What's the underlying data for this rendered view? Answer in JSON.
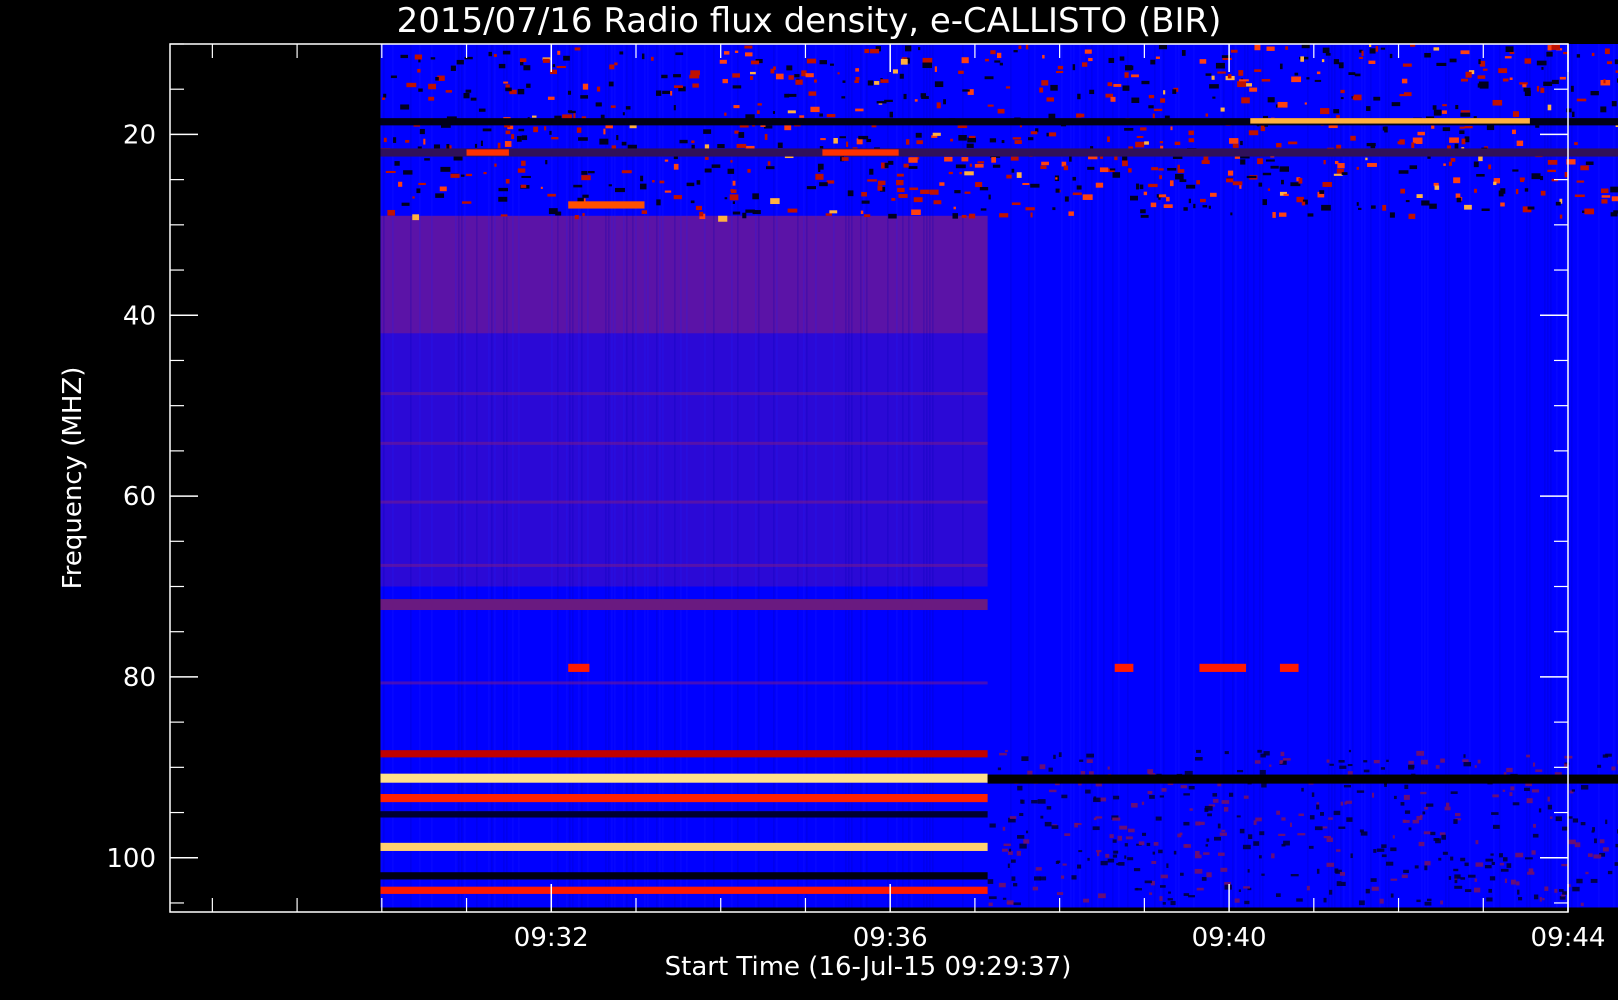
{
  "chart_data": {
    "type": "heatmap",
    "title": "2015/07/16  Radio flux density, e-CALLISTO (BIR)",
    "xlabel": "Start Time (16-Jul-15 09:29:37)",
    "ylabel": "Frequency (MHZ)",
    "y_axis": {
      "inverted": true,
      "range": [
        10,
        106
      ],
      "ticks": [
        20,
        40,
        60,
        80,
        100
      ],
      "tick_labels": [
        "20",
        "40",
        "60",
        "80",
        "100"
      ],
      "minor_step": 5
    },
    "x_axis": {
      "range_minutes": [
        -2.5,
        14.0
      ],
      "ticks_minutes": [
        2,
        6,
        10,
        14
      ],
      "tick_labels": [
        "09:32",
        "09:36",
        "09:40",
        "09:44"
      ],
      "minor_step_minutes": 1
    },
    "data_extent": {
      "time_start_minutes": -0.0167,
      "time_end_minutes": 15.0,
      "freq_min": 10,
      "freq_max": 105.5,
      "second_segment_start_minutes": 7.15
    },
    "colors": {
      "background": "#0000ff",
      "bright": "#ffd060",
      "mid": "#ff2000",
      "dark": "#000000",
      "segment1_tint": "#7a1a8a"
    },
    "features": [
      {
        "kind": "band",
        "segment": 1,
        "freq": 91.2,
        "width": 1.0,
        "color": "#ffe08a",
        "label": "bright band"
      },
      {
        "kind": "band",
        "segment": 1,
        "freq": 98.8,
        "width": 0.9,
        "color": "#ffd070",
        "label": "bright band"
      },
      {
        "kind": "band",
        "segment": 1,
        "freq": 93.4,
        "width": 0.9,
        "color": "#ff2000",
        "label": "red band"
      },
      {
        "kind": "band",
        "segment": 1,
        "freq": 103.6,
        "width": 0.8,
        "color": "#ff1800",
        "label": "red band"
      },
      {
        "kind": "band",
        "segment": 1,
        "freq": 88.5,
        "width": 0.8,
        "color": "#c00000",
        "label": "red band"
      },
      {
        "kind": "band",
        "segment": 1,
        "freq": 102.0,
        "width": 0.8,
        "color": "#000010",
        "label": "dark band"
      },
      {
        "kind": "band",
        "segment": 1,
        "freq": 95.2,
        "width": 0.7,
        "color": "#000030",
        "label": "dark band"
      },
      {
        "kind": "band",
        "segment": 1,
        "freq": 72.0,
        "width": 1.2,
        "color": "#6a1a80",
        "label": "purple band"
      },
      {
        "kind": "band",
        "segment": 2,
        "freq": 91.3,
        "width": 1.0,
        "color": "#000000",
        "label": "dark band"
      },
      {
        "kind": "band",
        "segment": "all",
        "freq": 18.6,
        "width": 0.8,
        "color": "#000018",
        "label": "dark band"
      },
      {
        "kind": "band",
        "segment": "all",
        "freq": 22.0,
        "width": 0.9,
        "color": "#30105a",
        "label": "band"
      },
      {
        "kind": "burst",
        "t": 2.2,
        "freq": 79.0,
        "dt": 0.25,
        "df": 0.9,
        "color": "#ff1a00"
      },
      {
        "kind": "burst",
        "t": 8.65,
        "freq": 79.0,
        "dt": 0.22,
        "df": 0.9,
        "color": "#ff1a00"
      },
      {
        "kind": "burst",
        "t": 9.65,
        "freq": 79.0,
        "dt": 0.55,
        "df": 0.9,
        "color": "#ff1a00"
      },
      {
        "kind": "burst",
        "t": 10.6,
        "freq": 79.0,
        "dt": 0.22,
        "df": 0.9,
        "color": "#ff1a00"
      },
      {
        "kind": "burst",
        "t": 10.25,
        "freq": 18.5,
        "dt": 3.3,
        "df": 0.6,
        "color": "#ffb040"
      },
      {
        "kind": "burst",
        "t": 1.0,
        "freq": 22.0,
        "dt": 0.5,
        "df": 0.7,
        "color": "#ff3000"
      },
      {
        "kind": "burst",
        "t": 5.2,
        "freq": 22.0,
        "dt": 0.9,
        "df": 0.7,
        "color": "#ff3000"
      },
      {
        "kind": "burst",
        "t": 2.2,
        "freq": 27.8,
        "dt": 0.9,
        "df": 0.8,
        "color": "#ff5000"
      }
    ]
  }
}
